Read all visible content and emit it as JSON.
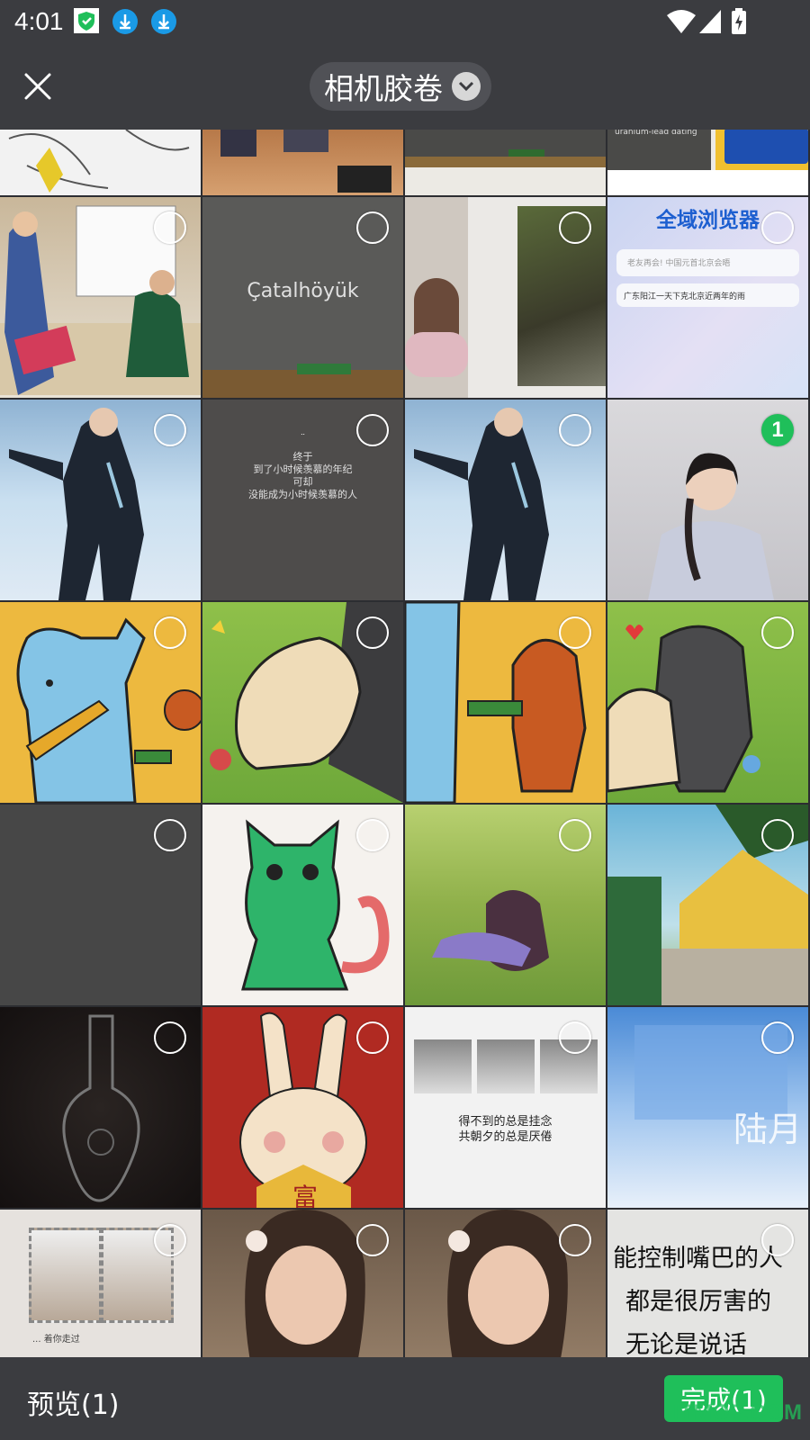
{
  "status": {
    "time": "4:01"
  },
  "header": {
    "album_title": "相机胶卷"
  },
  "tiles": {
    "catalhoyuk": "Çatalhöyük",
    "uranium": "uranium-lead dating",
    "browser_title": "全域浏览器",
    "browser_search": "老友再会! 中国元首北京会晤",
    "browser_news": "广东阳江一天下克北京近两年的雨",
    "text_note": [
      "¨",
      "终于",
      "到了小时候羡慕的年纪",
      "可却",
      "没能成为小时候羡慕的人"
    ],
    "rabbit_char": "富",
    "photo_quote_1": "得不到的总是挂念",
    "photo_quote_2": "共朝夕的总是厌倦",
    "sky_text": "陆月",
    "stamp_caption": "... 着你走过",
    "quote_lines": [
      "能控制嘴巴的人",
      "都是很厉害的",
      "无论是说话"
    ]
  },
  "selection": {
    "selected_number": "1"
  },
  "bottom": {
    "preview_label": "预览(1)",
    "done_label": "完成(1)"
  },
  "watermark": "ITMOP.COM",
  "colors": {
    "accent": "#1fbf5a",
    "bar": "#3b3c40"
  }
}
